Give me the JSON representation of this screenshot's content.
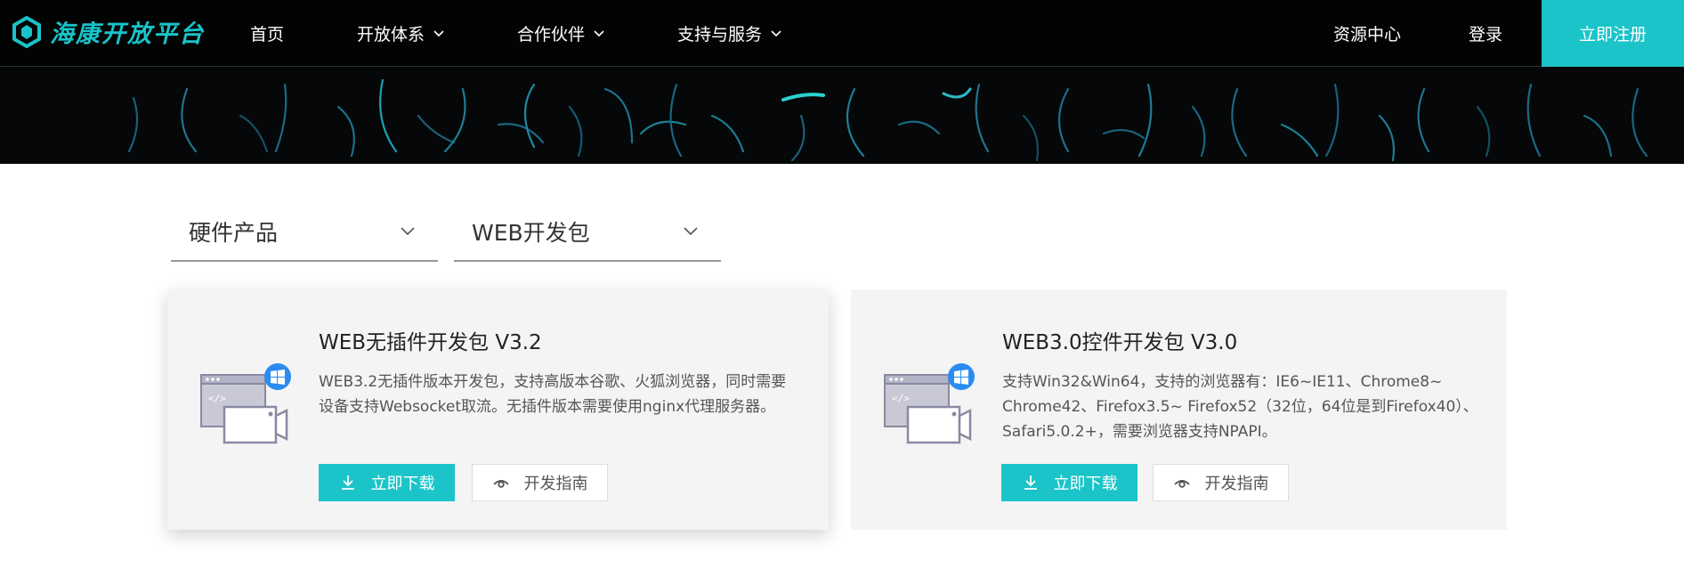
{
  "nav": {
    "logo_text": "海康开放平台",
    "items": [
      {
        "label": "首页"
      },
      {
        "label": "开放体系"
      },
      {
        "label": "合作伙伴"
      },
      {
        "label": "支持与服务"
      }
    ],
    "resource_center": "资源中心",
    "login": "登录",
    "register": "立即注册"
  },
  "filters": [
    {
      "label": "硬件产品"
    },
    {
      "label": "WEB开发包"
    }
  ],
  "cards": [
    {
      "title": "WEB无插件开发包 V3.2",
      "description": "WEB3.2无插件版本开发包，支持高版本谷歌、火狐浏览器，同时需要设备支持Websocket取流。无插件版本需要使用nginx代理服务器。",
      "download_label": "立即下载",
      "guide_label": "开发指南"
    },
    {
      "title": "WEB3.0控件开发包 V3.0",
      "description": "支持Win32&Win64，支持的浏览器有：IE6~IE11、Chrome8~ Chrome42、Firefox3.5~ Firefox52（32位，64位是到Firefox40）、Safari5.0.2+，需要浏览器支持NPAPI。",
      "download_label": "立即下载",
      "guide_label": "开发指南"
    }
  ],
  "colors": {
    "accent": "#1bc4c9",
    "nav_bg": "#050708",
    "card_bg": "#f4f4f4"
  }
}
